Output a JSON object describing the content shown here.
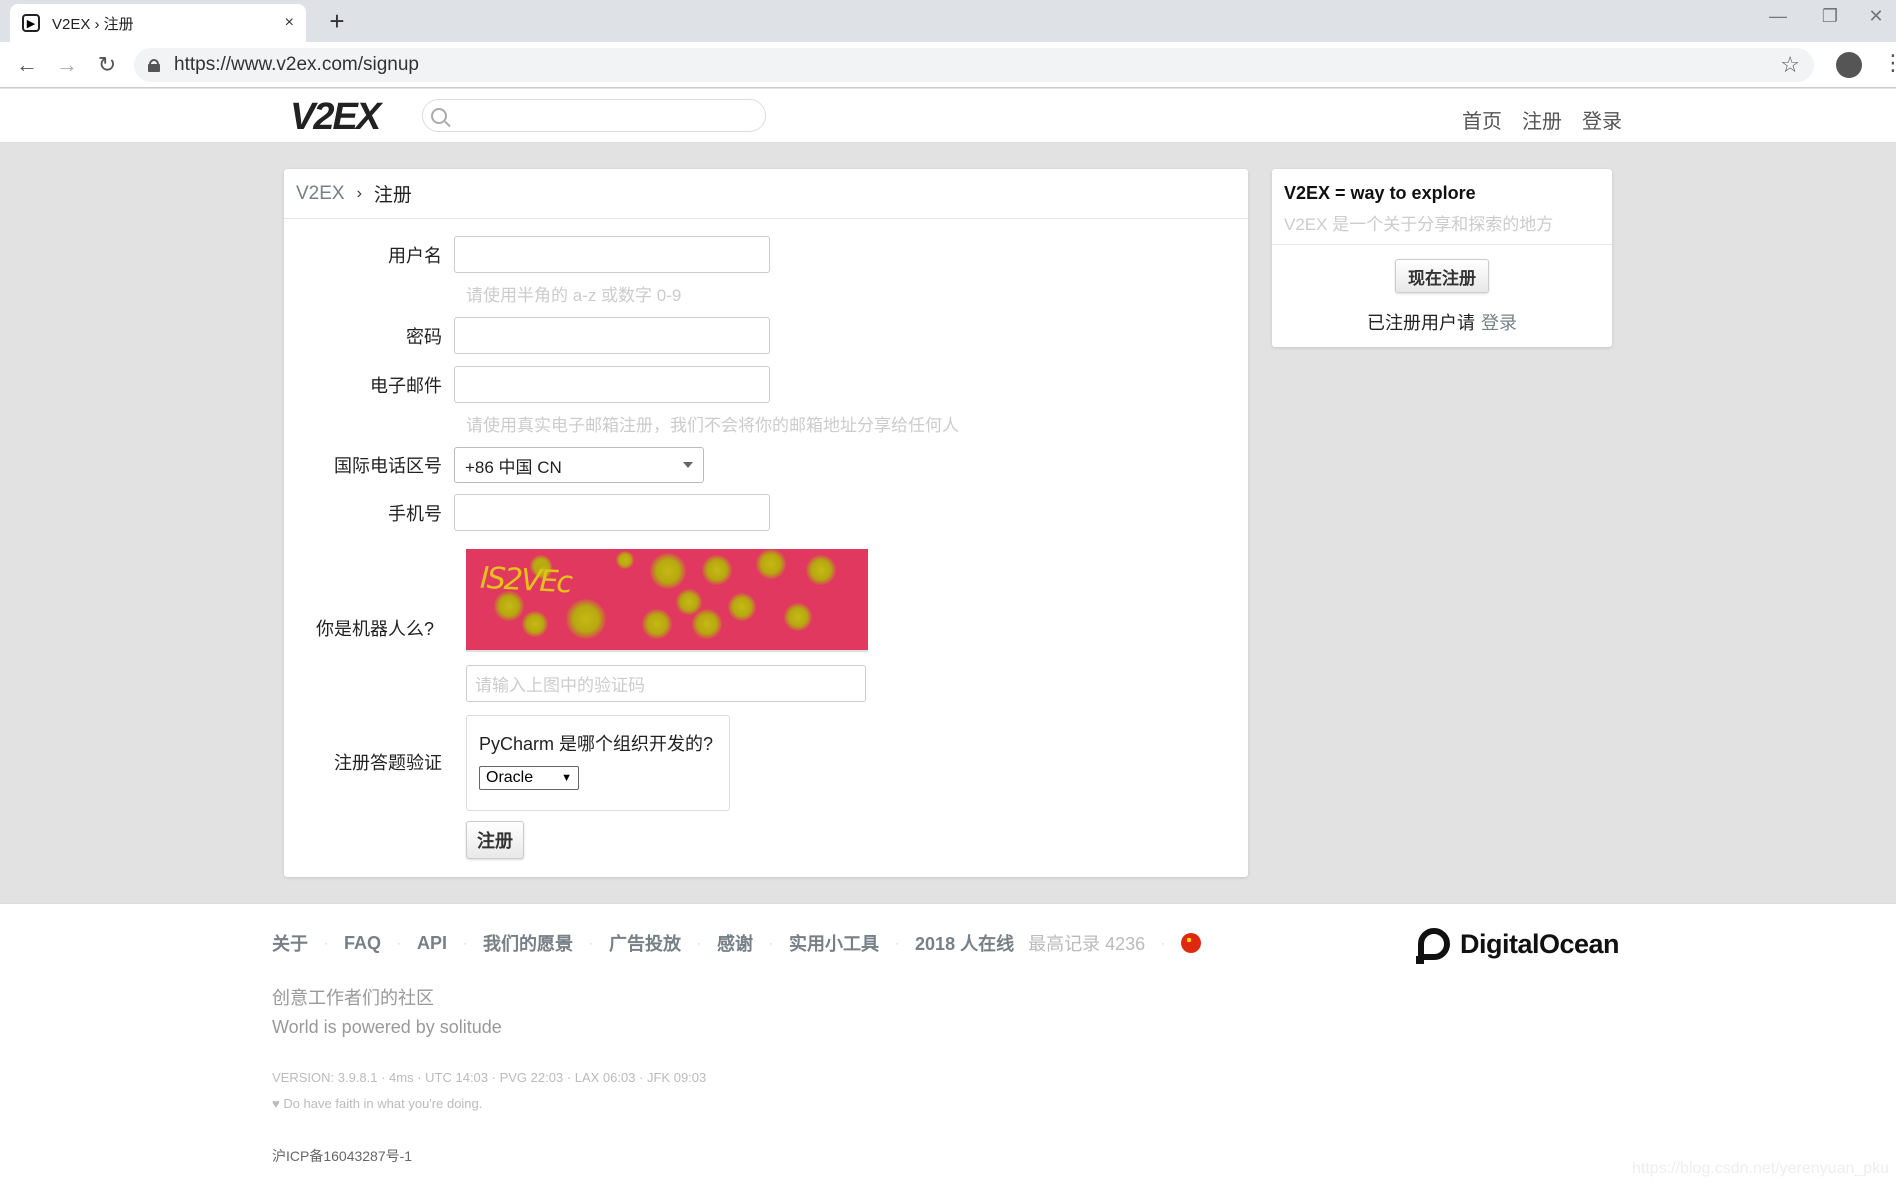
{
  "browser": {
    "tab_title": "V2EX › 注册",
    "favicon": "V2EX-favicon",
    "new_tab": "+",
    "close_tab": "×",
    "url": "https://www.v2ex.com/signup"
  },
  "header": {
    "logo": "V2EX",
    "search_placeholder": "",
    "nav": [
      "首页",
      "注册",
      "登录"
    ]
  },
  "breadcrumb": {
    "home": "V2EX",
    "sep": "›",
    "current": "注册"
  },
  "form": {
    "username_label": "用户名",
    "username_hint": "请使用半角的 a-z 或数字 0-9",
    "password_label": "密码",
    "email_label": "电子邮件",
    "email_hint": "请使用真实电子邮箱注册，我们不会将你的邮箱地址分享给任何人",
    "country_code_label": "国际电话区号",
    "country_code_value": "+86 中国 CN",
    "phone_label": "手机号",
    "robot_label": "你是机器人么?",
    "captcha_text": "IS2VEc",
    "captcha_placeholder": "请输入上图中的验证码",
    "quiz_label": "注册答题验证",
    "quiz_question": "PyCharm 是哪个组织开发的?",
    "quiz_answer": "Oracle",
    "submit_label": "注册"
  },
  "sidebar": {
    "title": "V2EX = way to explore",
    "subtitle": "V2EX 是一个关于分享和探索的地方",
    "signup_button": "现在注册",
    "login_prompt": "已注册用户请",
    "login_link": "登录"
  },
  "footer": {
    "links": [
      "关于",
      "FAQ",
      "API",
      "我们的愿景",
      "广告投放",
      "感谢",
      "实用小工具"
    ],
    "online": "2018 人在线",
    "record": "最高记录 4236",
    "sponsor": "DigitalOcean",
    "slogan": "创意工作者们的社区",
    "powered": "World is powered by solitude",
    "version": "VERSION: 3.9.8.1 · 4ms · UTC 14:03 · PVG 22:03 · LAX 06:03 · JFK 09:03",
    "faith": "♥ Do have faith in what you're doing.",
    "icp": "沪ICP备16043287号-1",
    "watermark": "https://blog.csdn.net/yerenyuan_pku"
  },
  "colors": {
    "captcha_bg": "#e0385f",
    "link_gray": "#778087",
    "hint_gray": "#cccccc"
  }
}
